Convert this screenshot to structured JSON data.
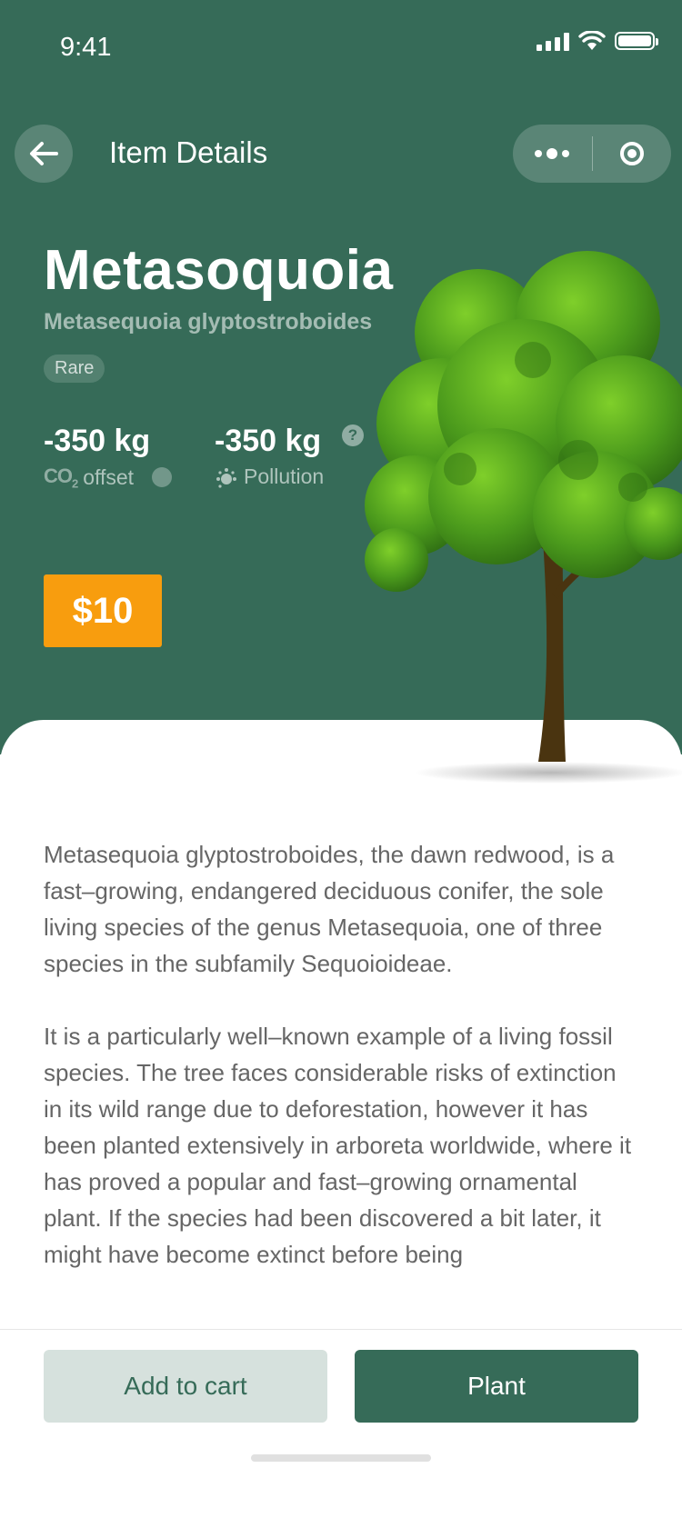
{
  "status_bar": {
    "time": "9:41",
    "icons": [
      "signal-icon",
      "wifi-icon",
      "battery-icon"
    ]
  },
  "nav": {
    "title": "Item Details",
    "icons": [
      "back-arrow-icon",
      "more-dots-icon",
      "target-icon"
    ]
  },
  "plant": {
    "common_name": "Metasoquoia",
    "scientific_name": "Metasequoia glyptostroboides",
    "tag": "Rare",
    "stats": [
      {
        "value": "-350 kg",
        "icon_text": "CO",
        "icon_sub": "2",
        "label": "offset"
      },
      {
        "value": "-350 kg",
        "icon": "pollution-icon",
        "label": "Pollution"
      }
    ],
    "help_icon_text": "?",
    "price": "$10"
  },
  "description": [
    "Metasequoia glyptostroboides, the dawn redwood, is a fast–growing, endangered deciduous conifer, the sole living species of the genus Metasequoia, one of three species in the subfamily Sequoioideae.",
    "It is a particularly well–known example of a living fossil species. The tree faces considerable risks of extinction in its wild range due to deforestation, however it has been planted extensively in arboreta worldwide, where it has proved a popular and fast–growing ornamental plant. If the species had been discovered a bit later, it might have become extinct before being"
  ],
  "actions": {
    "add_to_cart": "Add to cart",
    "plant": "Plant"
  },
  "colors": {
    "primary": "#366b58",
    "price": "#f89d0e",
    "secondary_button": "#d6e1dd"
  }
}
